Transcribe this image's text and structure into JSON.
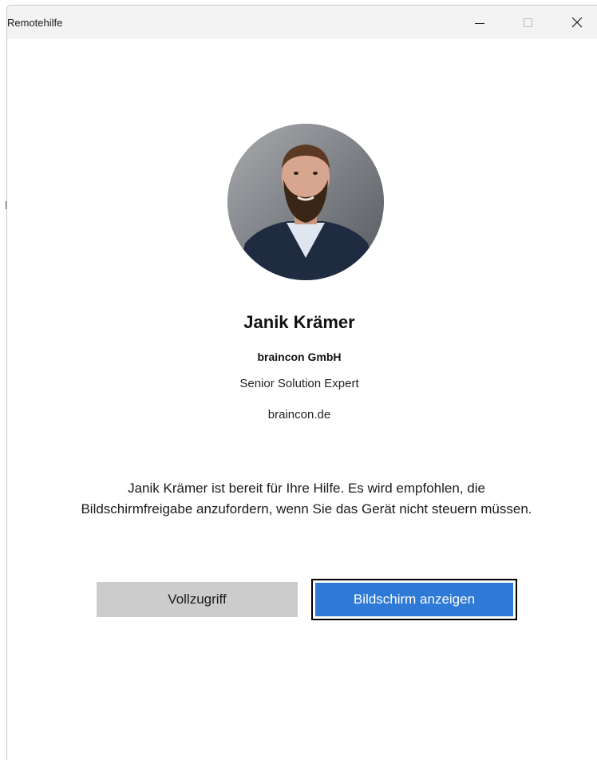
{
  "window": {
    "title": "Remotehilfe",
    "minimize_icon": "minimize-icon",
    "maximize_icon": "maximize-icon",
    "close_icon": "close-icon"
  },
  "profile": {
    "avatar_icon": "profile-photo",
    "name": "Janik Krämer",
    "company": "braincon GmbH",
    "role": "Senior Solution Expert",
    "website": "braincon.de"
  },
  "message": {
    "line1": "Janik Krämer ist bereit für Ihre Hilfe. Es wird empfohlen, die",
    "line2": "Bildschirmfreigabe anzufordern, wenn Sie das Gerät nicht steuern müssen."
  },
  "actions": {
    "full_access_label": "Vollzugriff",
    "view_screen_label": "Bildschirm anzeigen"
  },
  "colors": {
    "primary_button": "#2f7ad6",
    "secondary_button": "#cccccc",
    "titlebar": "#f3f3f3"
  }
}
